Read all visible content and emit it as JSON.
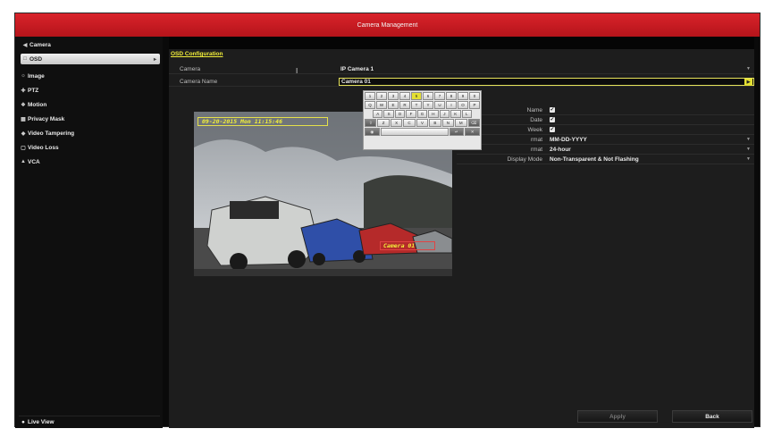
{
  "window": {
    "title": "Camera Management"
  },
  "sidebar": {
    "header": {
      "label": "Camera",
      "icon": "camera-icon"
    },
    "items": [
      {
        "label": "OSD",
        "icon": "osd-icon",
        "active": true
      },
      {
        "label": "Image",
        "icon": "image-icon"
      },
      {
        "label": "PTZ",
        "icon": "ptz-icon"
      },
      {
        "label": "Motion",
        "icon": "motion-icon"
      },
      {
        "label": "Privacy Mask",
        "icon": "privacy-mask-icon"
      },
      {
        "label": "Video Tampering",
        "icon": "video-tampering-icon"
      },
      {
        "label": "Video Loss",
        "icon": "video-loss-icon"
      },
      {
        "label": "VCA",
        "icon": "vca-icon"
      }
    ],
    "live_view": {
      "label": "Live View",
      "icon": "home-icon"
    }
  },
  "main": {
    "tab": "OSD Configuration",
    "camera": {
      "label": "Camera",
      "value": "IP Camera 1"
    },
    "camera_name": {
      "label": "Camera Name",
      "value": "Camera 01"
    },
    "preview": {
      "date_overlay": "09-20-2015 Mon 11:15:46",
      "name_overlay": "Camera 01"
    },
    "options": {
      "display_name": {
        "label": "Name",
        "checked": true
      },
      "display_date": {
        "label": "Date",
        "checked": true
      },
      "display_week": {
        "label": "Week",
        "checked": true
      },
      "date_format": {
        "label": "rmat",
        "value": "MM-DD-YYYY"
      },
      "time_format": {
        "label": "rmat",
        "value": "24-hour"
      },
      "display_mode": {
        "label": "Display Mode",
        "value": "Non-Transparent & Not Flashing"
      }
    },
    "buttons": {
      "apply": "Apply",
      "back": "Back"
    }
  },
  "keyboard": {
    "row1": [
      "1",
      "2",
      "3",
      "4",
      "5",
      "6",
      "7",
      "8",
      "9",
      "0"
    ],
    "row2": [
      "Q",
      "W",
      "E",
      "R",
      "T",
      "Y",
      "U",
      "I",
      "O",
      "P"
    ],
    "row3": [
      "A",
      "S",
      "D",
      "F",
      "G",
      "H",
      "J",
      "K",
      "L"
    ],
    "row4": [
      "Z",
      "X",
      "C",
      "V",
      "B",
      "N",
      "M"
    ],
    "highlighted_key": "5"
  },
  "colors": {
    "accent_red": "#d9232b",
    "highlight_yellow": "#e4e033"
  }
}
